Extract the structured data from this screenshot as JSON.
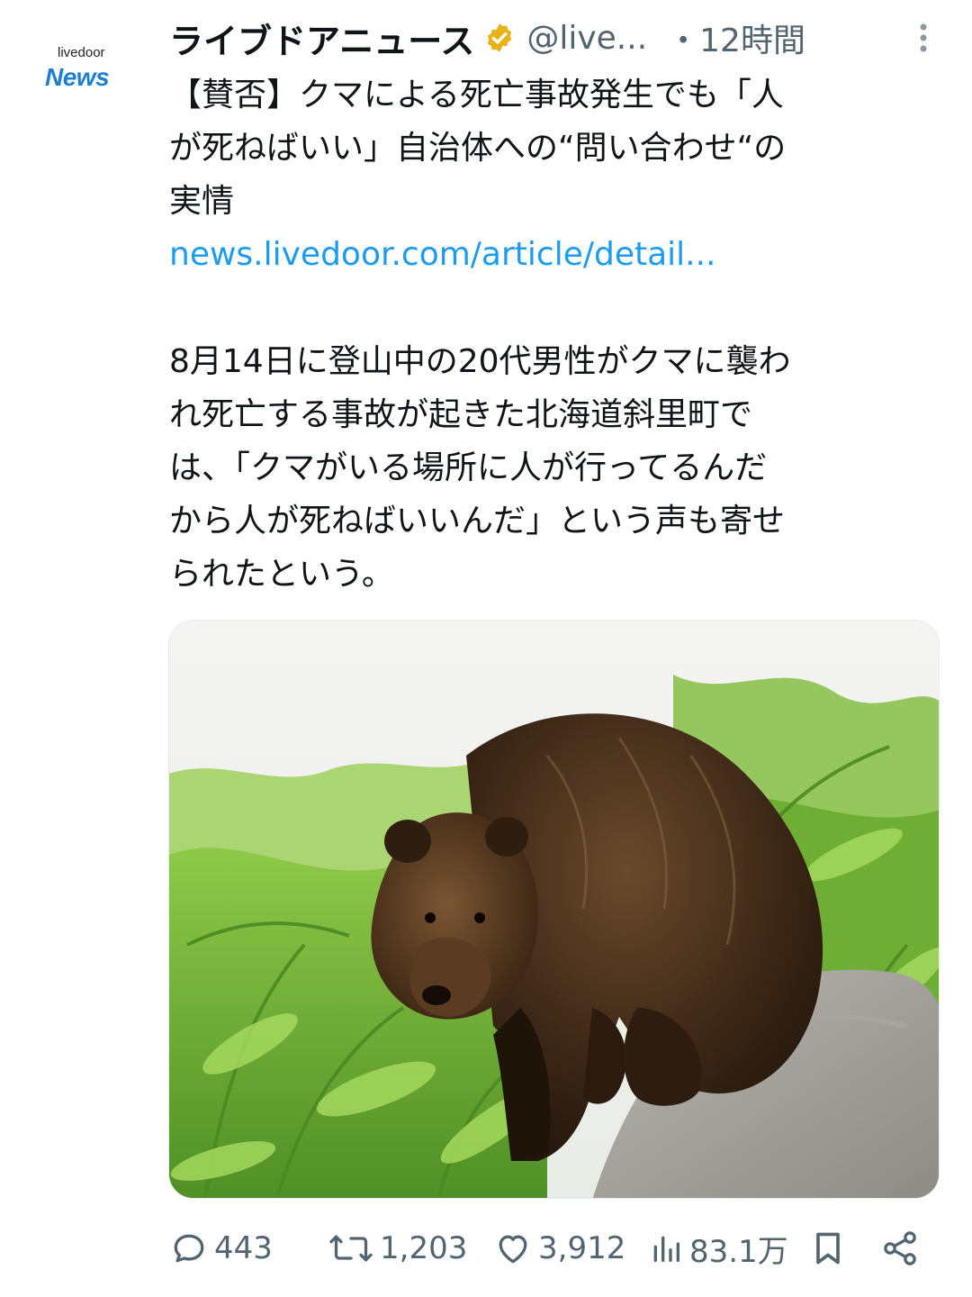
{
  "account": {
    "avatar_small_text": "livedoor",
    "avatar_news_text": "News",
    "display_name": "ライブドアニュース",
    "handle": "@live...",
    "separator": "・",
    "time": "12時間"
  },
  "tweet": {
    "headline_lines": [
      "【賛否】クマによる死亡事故発生でも「人",
      "が死ねばいい」自治体への“問い合わせ“の",
      "実情"
    ],
    "link": "news.livedoor.com/article/detail...",
    "body_lines": [
      "8月14日に登山中の20代男性がクマに襲わ",
      "れ死亡する事故が起きた北海道斜里町で",
      "は、「クマがいる場所に人が行ってるんだ",
      "から人が死ねばいいんだ」という声も寄せ",
      "られたという。"
    ]
  },
  "media": {
    "description_icon": "bear-photo"
  },
  "actions": {
    "replies": "443",
    "retweets": "1,203",
    "likes": "3,912",
    "views": "83.1万"
  },
  "colors": {
    "accent": "#1d9bf0",
    "muted": "#536471",
    "verified_gold": "#e8b21a",
    "news_blue": "#1d7fd0"
  }
}
